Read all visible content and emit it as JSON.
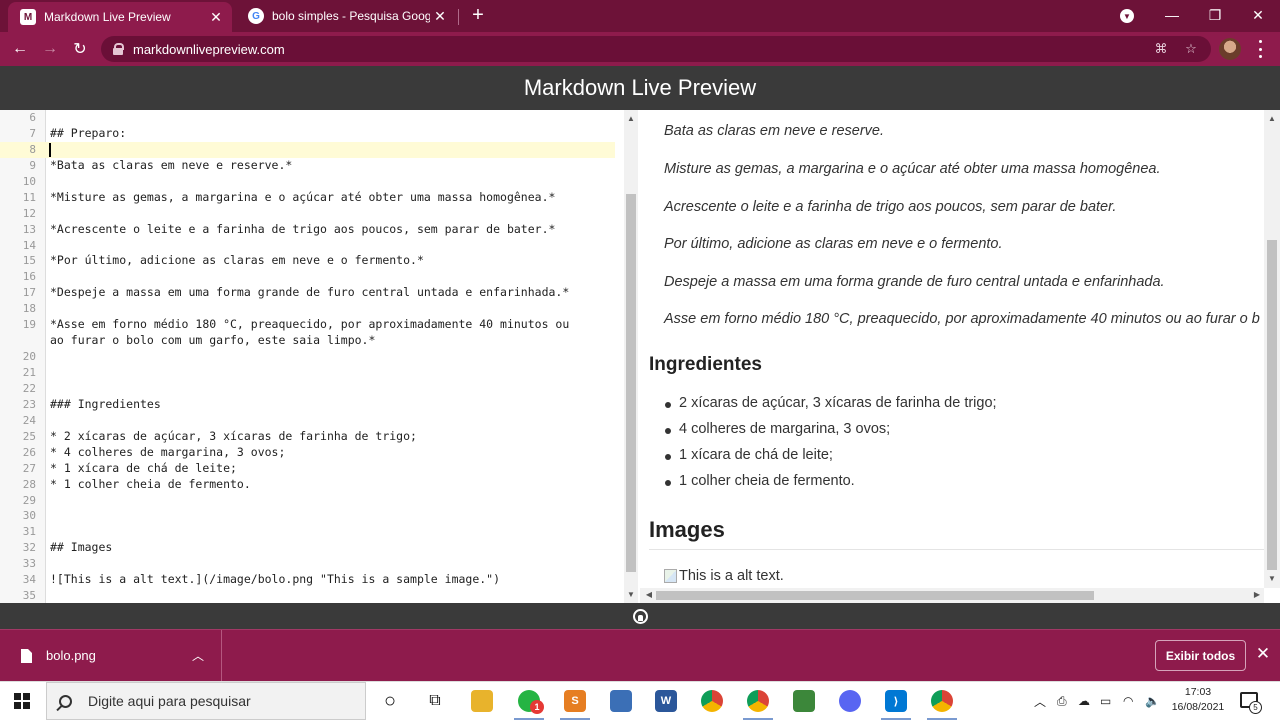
{
  "browser": {
    "tabs": [
      {
        "title": "Markdown Live Preview",
        "favicon": "M",
        "active": true
      },
      {
        "title": "bolo simples - Pesquisa Google",
        "favicon": "G",
        "active": false
      }
    ],
    "url": "markdownlivepreview.com"
  },
  "app": {
    "title": "Markdown Live Preview"
  },
  "editor": {
    "lines": [
      {
        "n": "6",
        "t": ""
      },
      {
        "n": "7",
        "t": "## Preparo:"
      },
      {
        "n": "8",
        "t": ""
      },
      {
        "n": "9",
        "t": "*Bata as claras em neve e reserve.*"
      },
      {
        "n": "10",
        "t": ""
      },
      {
        "n": "11",
        "t": "*Misture as gemas, a margarina e o açúcar até obter uma massa homogênea.*"
      },
      {
        "n": "12",
        "t": ""
      },
      {
        "n": "13",
        "t": "*Acrescente o leite e a farinha de trigo aos poucos, sem parar de bater.*"
      },
      {
        "n": "14",
        "t": ""
      },
      {
        "n": "15",
        "t": "*Por último, adicione as claras em neve e o fermento.*"
      },
      {
        "n": "16",
        "t": ""
      },
      {
        "n": "17",
        "t": "*Despeje a massa em uma forma grande de furo central untada e enfarinhada.*"
      },
      {
        "n": "18",
        "t": ""
      },
      {
        "n": "19",
        "t": "*Asse em forno médio 180 °C, preaquecido, por aproximadamente 40 minutos ou"
      },
      {
        "n": "",
        "t": "ao furar o bolo com um garfo, este saia limpo.*"
      },
      {
        "n": "20",
        "t": ""
      },
      {
        "n": "21",
        "t": ""
      },
      {
        "n": "22",
        "t": ""
      },
      {
        "n": "23",
        "t": "### Ingredientes"
      },
      {
        "n": "24",
        "t": ""
      },
      {
        "n": "25",
        "t": "* 2 xícaras de açúcar, 3 xícaras de farinha de trigo;"
      },
      {
        "n": "26",
        "t": "* 4 colheres de margarina, 3 ovos;"
      },
      {
        "n": "27",
        "t": "* 1 xícara de chá de leite;"
      },
      {
        "n": "28",
        "t": "* 1 colher cheia de fermento."
      },
      {
        "n": "29",
        "t": ""
      },
      {
        "n": "30",
        "t": ""
      },
      {
        "n": "31",
        "t": ""
      },
      {
        "n": "32",
        "t": "## Images"
      },
      {
        "n": "33",
        "t": ""
      },
      {
        "n": "34",
        "t": "![This is a alt text.](/image/bolo.png \"This is a sample image.\")"
      },
      {
        "n": "35",
        "t": ""
      }
    ]
  },
  "preview": {
    "paragraphs": [
      "Bata as claras em neve e reserve.",
      "Misture as gemas, a margarina e o açúcar até obter uma massa homogênea.",
      "Acrescente o leite e a farinha de trigo aos poucos, sem parar de bater.",
      "Por último, adicione as claras em neve e o fermento.",
      "Despeje a massa em uma forma grande de furo central untada e enfarinhada.",
      "Asse em forno médio 180 °C, preaquecido, por aproximadamente 40 minutos ou ao furar o b"
    ],
    "ingredients_heading": "Ingredientes",
    "ingredients": [
      "2 xícaras de açúcar, 3 xícaras de farinha de trigo;",
      "4 colheres de margarina, 3 ovos;",
      "1 xícara de chá de leite;",
      "1 colher cheia de fermento."
    ],
    "images_heading": "Images",
    "image_alt": "This is a alt text."
  },
  "downloads": {
    "file_name": "bolo.png",
    "show_all_label": "Exibir todos"
  },
  "taskbar": {
    "search_placeholder": "Digite aqui para pesquisar",
    "time": "17:03",
    "date": "16/08/2021",
    "whatsapp_badge": "1",
    "notification_count": "5"
  }
}
